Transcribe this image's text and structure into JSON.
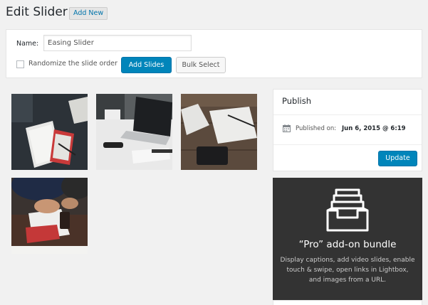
{
  "header": {
    "title": "Edit Slider",
    "add_new": "Add New"
  },
  "form": {
    "name_label": "Name:",
    "name_value": "Easing Slider",
    "randomize_label": "Randomize the slide order",
    "add_slides": "Add Slides",
    "bulk_select": "Bulk Select"
  },
  "slides": [
    {
      "id": "slide-1",
      "theme": "notebooks-on-dark-desk"
    },
    {
      "id": "slide-2",
      "theme": "laptop-on-white-table"
    },
    {
      "id": "slide-3",
      "theme": "notebooks-on-wood"
    },
    {
      "id": "slide-4",
      "theme": "people-writing-at-table"
    }
  ],
  "publish": {
    "title": "Publish",
    "published_label": "Published on:",
    "date": "Jun 6, 2015 @ 6:19",
    "update": "Update",
    "calendar_icon": "calendar-icon"
  },
  "promo": {
    "icon": "inbox-tray-icon",
    "title": "“Pro” add-on bundle",
    "description": "Display captions, add video slides, enable touch & swipe, open links in Lightbox, and images from a URL."
  },
  "colors": {
    "primary": "#0085ba",
    "link": "#0073aa",
    "promo_bg": "#333333",
    "page_bg": "#f1f1f1"
  }
}
